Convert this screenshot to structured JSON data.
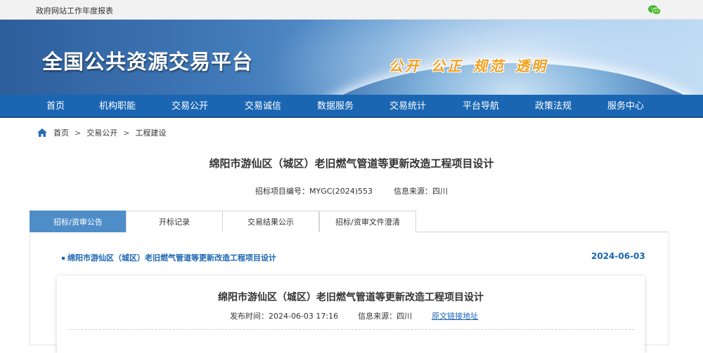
{
  "topbar": {
    "report_link": "政府网站工作年度报表",
    "wechat_icon": "wechat-icon"
  },
  "banner": {
    "title": "全国公共资源交易平台",
    "slogan": [
      "公开",
      "公正",
      "规范",
      "透明"
    ]
  },
  "nav": [
    "首页",
    "机构职能",
    "交易公开",
    "交易诚信",
    "数据服务",
    "交易统计",
    "平台导航",
    "政策法规",
    "服务中心"
  ],
  "breadcrumb": {
    "home_icon": "home-icon",
    "items": [
      "首页",
      "交易公开",
      "工程建设"
    ],
    "separator": ">"
  },
  "article": {
    "title": "绵阳市游仙区（城区）老旧燃气管道等更新改造工程项目设计",
    "project_no": "招标项目编号：MYGC(2024)553",
    "source": "信息来源：四川"
  },
  "tabs": [
    "招标/资审公告",
    "开标记录",
    "交易结果公示",
    "招标/资审文件澄清"
  ],
  "list": {
    "item_title": "绵阳市游仙区（城区）老旧燃气管道等更新改造工程项目设计",
    "item_date": "2024-06-03"
  },
  "detail": {
    "title": "绵阳市游仙区（城区）老旧燃气管道等更新改造工程项目设计",
    "publish_time": "发布时间：2024-06-03 17:16",
    "source": "信息来源：四川",
    "original_link": "原文链接地址"
  },
  "colors": {
    "nav_bg": "#1a66b3",
    "tab_active": "#4f8dc8",
    "link": "#1a66b3",
    "slogan": "#f2a01c"
  }
}
